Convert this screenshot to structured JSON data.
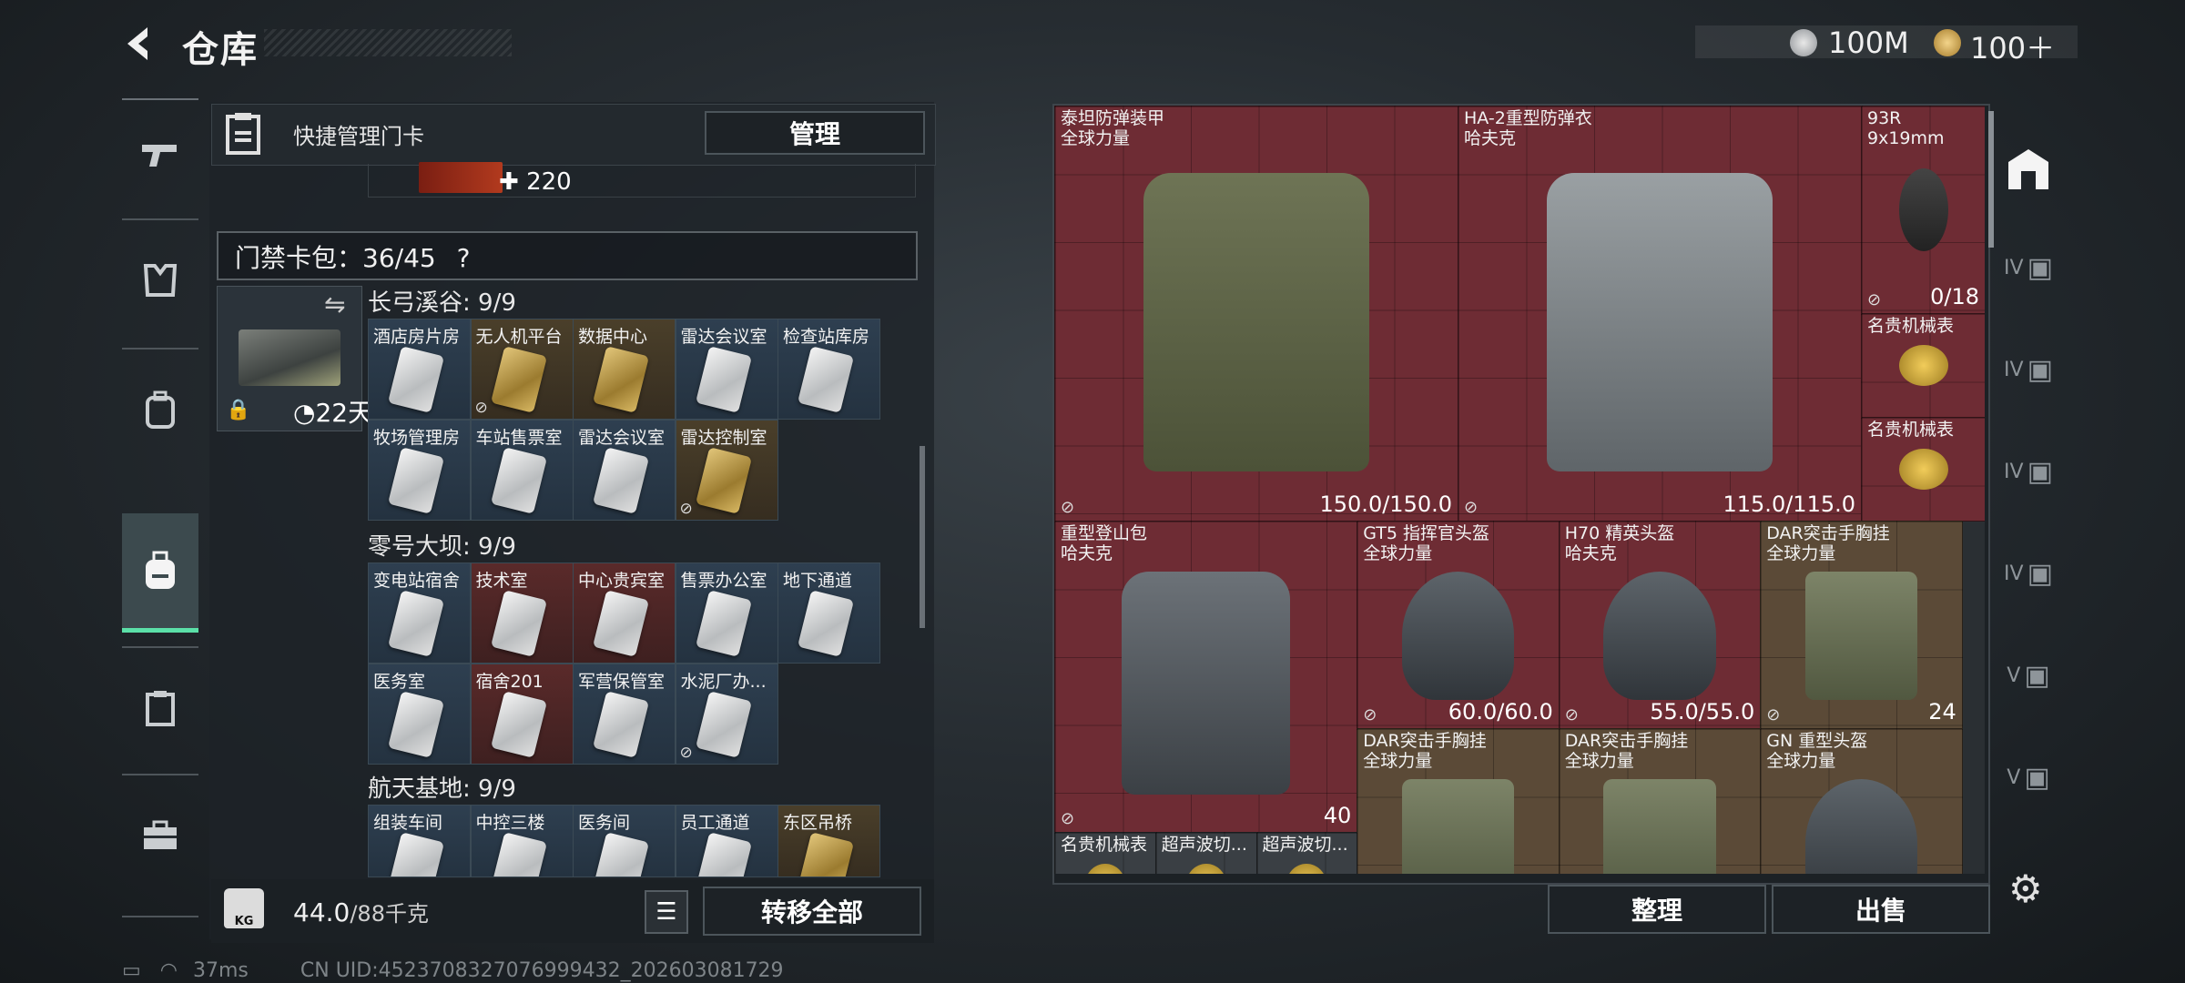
{
  "header": {
    "title": "仓库",
    "currency1": "100M",
    "currency2": "100＋"
  },
  "left_tabs": [
    "pistol-icon",
    "armor-vest-icon",
    "backpack-icon",
    "backpack-active-icon",
    "clipboard-icon",
    "toolbox-icon"
  ],
  "quick_manage": {
    "label": "快捷管理门卡",
    "button": "管理",
    "key_count": "220"
  },
  "wallet": {
    "label": "门禁卡包：36/45",
    "help": "?"
  },
  "card_pack": {
    "time": "22天"
  },
  "sections": [
    {
      "title": "长弓溪谷: 9/9",
      "cards": [
        {
          "label": "酒店房片房",
          "style": "blue"
        },
        {
          "label": "无人机平台",
          "style": "gold",
          "tag": true
        },
        {
          "label": "数据中心",
          "style": "gold"
        },
        {
          "label": "雷达会议室",
          "style": "blue"
        },
        {
          "label": "检查站库房",
          "style": "blue"
        },
        {
          "label": "牧场管理房",
          "style": "blue"
        },
        {
          "label": "车站售票室",
          "style": "blue"
        },
        {
          "label": "雷达会议室",
          "style": "blue"
        },
        {
          "label": "雷达控制室",
          "style": "gold",
          "tag": true
        }
      ]
    },
    {
      "title": "零号大坝: 9/9",
      "cards": [
        {
          "label": "变电站宿舍",
          "style": "blue"
        },
        {
          "label": "技术室",
          "style": "red"
        },
        {
          "label": "中心贵宾室",
          "style": "red"
        },
        {
          "label": "售票办公室",
          "style": "blue"
        },
        {
          "label": "地下通道",
          "style": "blue"
        },
        {
          "label": "医务室",
          "style": "blue"
        },
        {
          "label": "宿舍201",
          "style": "red"
        },
        {
          "label": "军营保管室",
          "style": "blue"
        },
        {
          "label": "水泥厂办...",
          "style": "blue",
          "tag": true
        }
      ]
    },
    {
      "title": "航天基地: 9/9",
      "cards": [
        {
          "label": "组装车间",
          "style": "blue"
        },
        {
          "label": "中控三楼",
          "style": "blue"
        },
        {
          "label": "医务间",
          "style": "blue"
        },
        {
          "label": "员工通道",
          "style": "blue"
        },
        {
          "label": "东区吊桥",
          "style": "gold"
        }
      ]
    }
  ],
  "bottom": {
    "weight": "44.0",
    "weight_max": "/88千克",
    "transfer_button": "转移全部"
  },
  "status": {
    "ping": "37ms",
    "uid": "CN UID:4523708327076999432_202603081729"
  },
  "items": [
    {
      "name": "泰坦防弹装甲\n全球力量",
      "value": "150.0/150.0",
      "color": "red"
    },
    {
      "name": "HA-2重型防弹衣\n哈夫克",
      "value": "115.0/115.0",
      "color": "red"
    },
    {
      "name": "93R\n9x19mm",
      "value": "0/18",
      "color": "red"
    },
    {
      "name": "名贵机械表",
      "value": "",
      "color": "red"
    },
    {
      "name": "名贵机械表",
      "value": "",
      "color": "red"
    },
    {
      "name": "重型登山包\n哈夫克",
      "value": "40",
      "color": "red"
    },
    {
      "name": "GT5 指挥官头盔\n全球力量",
      "value": "60.0/60.0",
      "color": "red"
    },
    {
      "name": "H70 精英头盔\n哈夫克",
      "value": "55.0/55.0",
      "color": "red"
    },
    {
      "name": "DAR突击手胸挂\n全球力量",
      "value": "24",
      "color": "brown"
    },
    {
      "name": "DAR突击手胸挂\n全球力量",
      "value": "",
      "color": "brown"
    },
    {
      "name": "DAR突击手胸挂\n全球力量",
      "value": "",
      "color": "brown"
    },
    {
      "name": "GN 重型头盔\n全球力量",
      "value": "",
      "color": "brown"
    },
    {
      "name": "名贵机械表",
      "value": "",
      "color": "dark"
    },
    {
      "name": "超声波切...",
      "value": "",
      "color": "dark"
    },
    {
      "name": "超声波切...",
      "value": "",
      "color": "dark"
    }
  ],
  "right_tabs": [
    "all-items-icon",
    "IV",
    "IV",
    "IV",
    "IV",
    "V",
    "V"
  ],
  "actions": {
    "sort": "整理",
    "sell": "出售"
  }
}
